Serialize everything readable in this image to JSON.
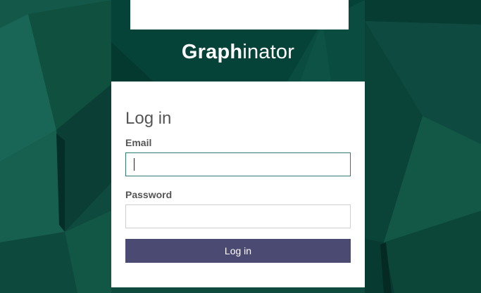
{
  "brand": {
    "bold_part": "Graph",
    "light_part": "inator"
  },
  "form": {
    "title": "Log in",
    "email_label": "Email",
    "email_value": "",
    "password_label": "Password",
    "password_value": "",
    "submit_label": "Log in"
  },
  "colors": {
    "background": "#0f4a3e",
    "header": "#054339",
    "button": "#4b4a73",
    "focus_border": "#2e7d74"
  }
}
